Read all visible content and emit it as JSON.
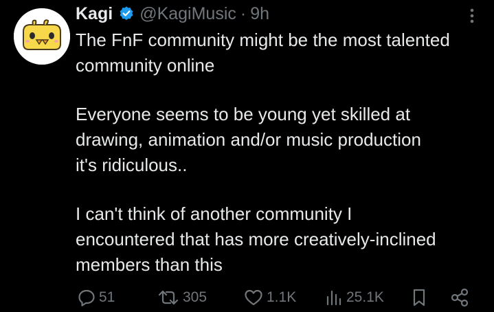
{
  "tweet": {
    "author_name": "Kagi",
    "handle": "@KagiMusic",
    "separator": "·",
    "time": "9h",
    "paragraphs": [
      [
        "The FnF community might be the most talented",
        "community online"
      ],
      [
        "Everyone seems to be young yet skilled at",
        "drawing, animation and/or music production",
        "it's ridiculous.."
      ],
      [
        "I can't think of another community I",
        "encountered that has more creatively-inclined",
        "members than this"
      ]
    ]
  },
  "actions": {
    "replies": "51",
    "reposts": "305",
    "likes": "1.1K",
    "views": "25.1K"
  },
  "icons": {
    "avatar": "chick-avatar",
    "verified": "verified-badge-icon",
    "more": "more-vertical-icon",
    "reply": "reply-icon",
    "repost": "repost-icon",
    "like": "heart-icon",
    "views": "views-icon",
    "bookmark": "bookmark-icon",
    "share": "share-icon"
  },
  "colors": {
    "background": "#000000",
    "text": "#e7e9ea",
    "muted": "#71767b",
    "verified": "#1d9bf0",
    "avatar_yellow": "#f7d84a"
  }
}
